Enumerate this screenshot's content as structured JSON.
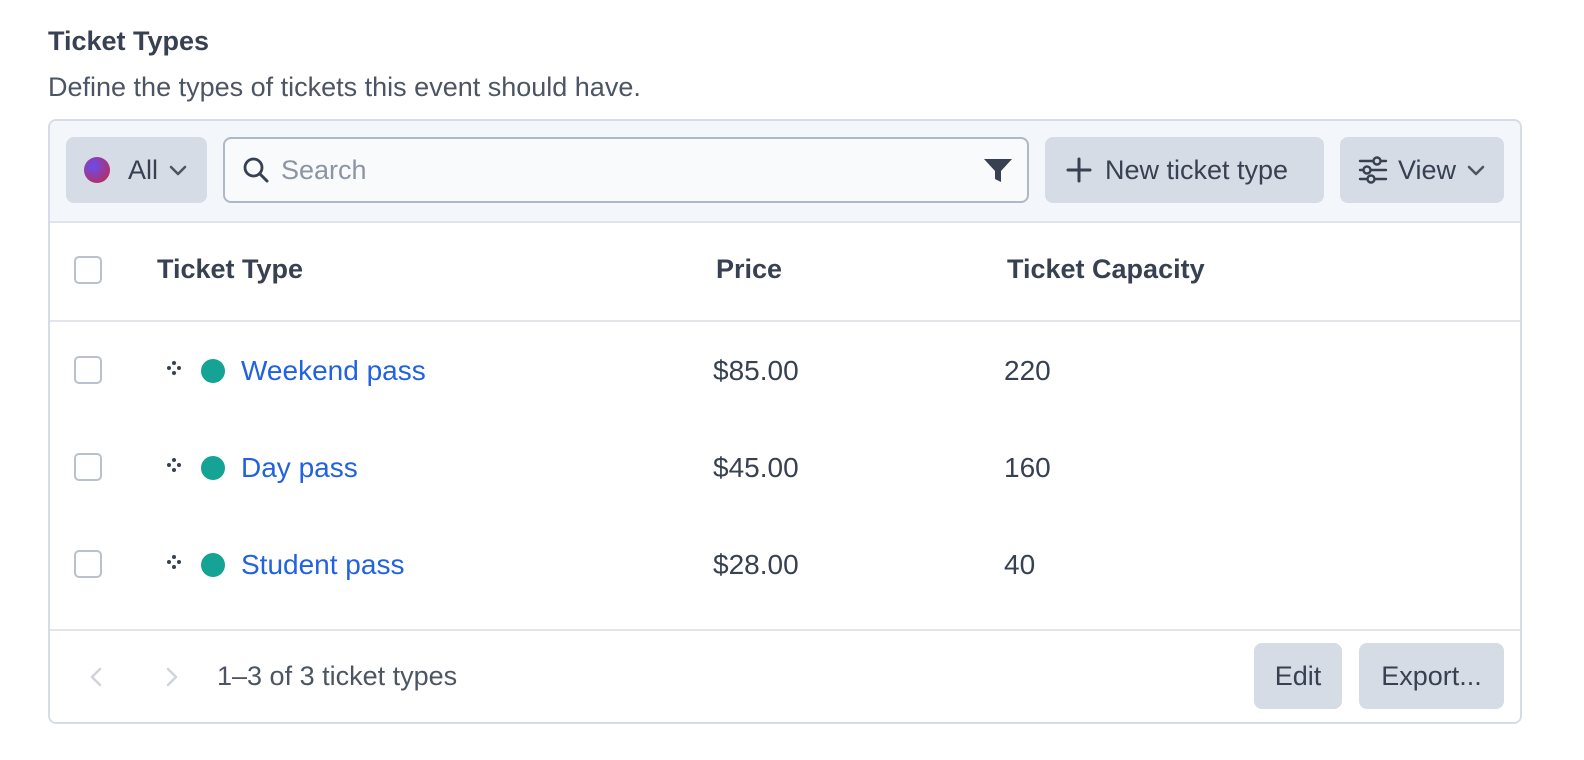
{
  "section": {
    "title": "Ticket Types",
    "description": "Define the types of tickets this event should have."
  },
  "toolbar": {
    "filter_label": "All",
    "search_placeholder": "Search",
    "new_button_label": "New ticket type",
    "view_button_label": "View"
  },
  "table": {
    "columns": [
      "Ticket Type",
      "Price",
      "Ticket Capacity"
    ],
    "rows": [
      {
        "name": "Weekend pass",
        "price": "$85.00",
        "capacity": "220"
      },
      {
        "name": "Day pass",
        "price": "$45.00",
        "capacity": "160"
      },
      {
        "name": "Student pass",
        "price": "$28.00",
        "capacity": "40"
      }
    ]
  },
  "footer": {
    "count_text": "1–3 of 3 ticket types",
    "edit_label": "Edit",
    "export_label": "Export..."
  },
  "colors": {
    "link": "#2162e0",
    "status_dot": "#14a394",
    "button_bg": "#d5dce6"
  },
  "icons": {
    "search": "search-icon",
    "filter": "funnel-icon",
    "add": "plus-icon",
    "view": "sliders-icon",
    "drag": "drag-handle-icon"
  }
}
